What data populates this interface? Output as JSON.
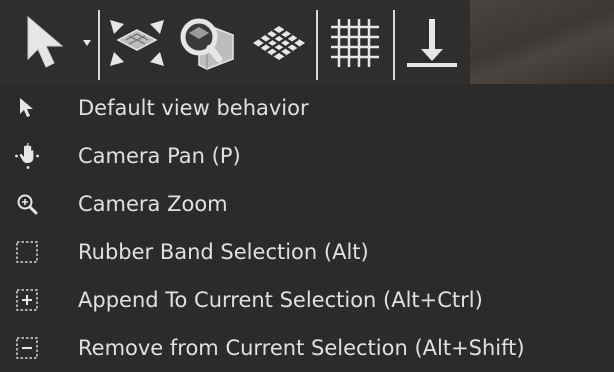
{
  "colors": {
    "background": "#2b2b2b",
    "text": "#e0e0e0",
    "icon": "#e6e6e6"
  },
  "toolbar": {
    "tools": [
      {
        "icon": "pointer-arrow-icon"
      },
      {
        "icon": "dropdown-arrow-icon"
      },
      {
        "icon": "fit-to-view-icon"
      },
      {
        "icon": "zoom-to-selection-icon"
      },
      {
        "icon": "grid-plane-icon"
      },
      {
        "icon": "grid-icon"
      },
      {
        "icon": "drop-to-floor-icon"
      }
    ]
  },
  "menu": {
    "items": [
      {
        "label": "Default view behavior",
        "icon": "pointer-arrow-icon"
      },
      {
        "label": "Camera Pan (P)",
        "icon": "pan-hand-icon"
      },
      {
        "label": "Camera Zoom",
        "icon": "zoom-icon"
      },
      {
        "label": "Rubber Band Selection (Alt)",
        "icon": "dashed-rectangle-icon"
      },
      {
        "label": "Append To Current Selection (Alt+Ctrl)",
        "icon": "dashed-plus-icon"
      },
      {
        "label": "Remove from Current Selection (Alt+Shift)",
        "icon": "dashed-minus-icon"
      }
    ]
  }
}
